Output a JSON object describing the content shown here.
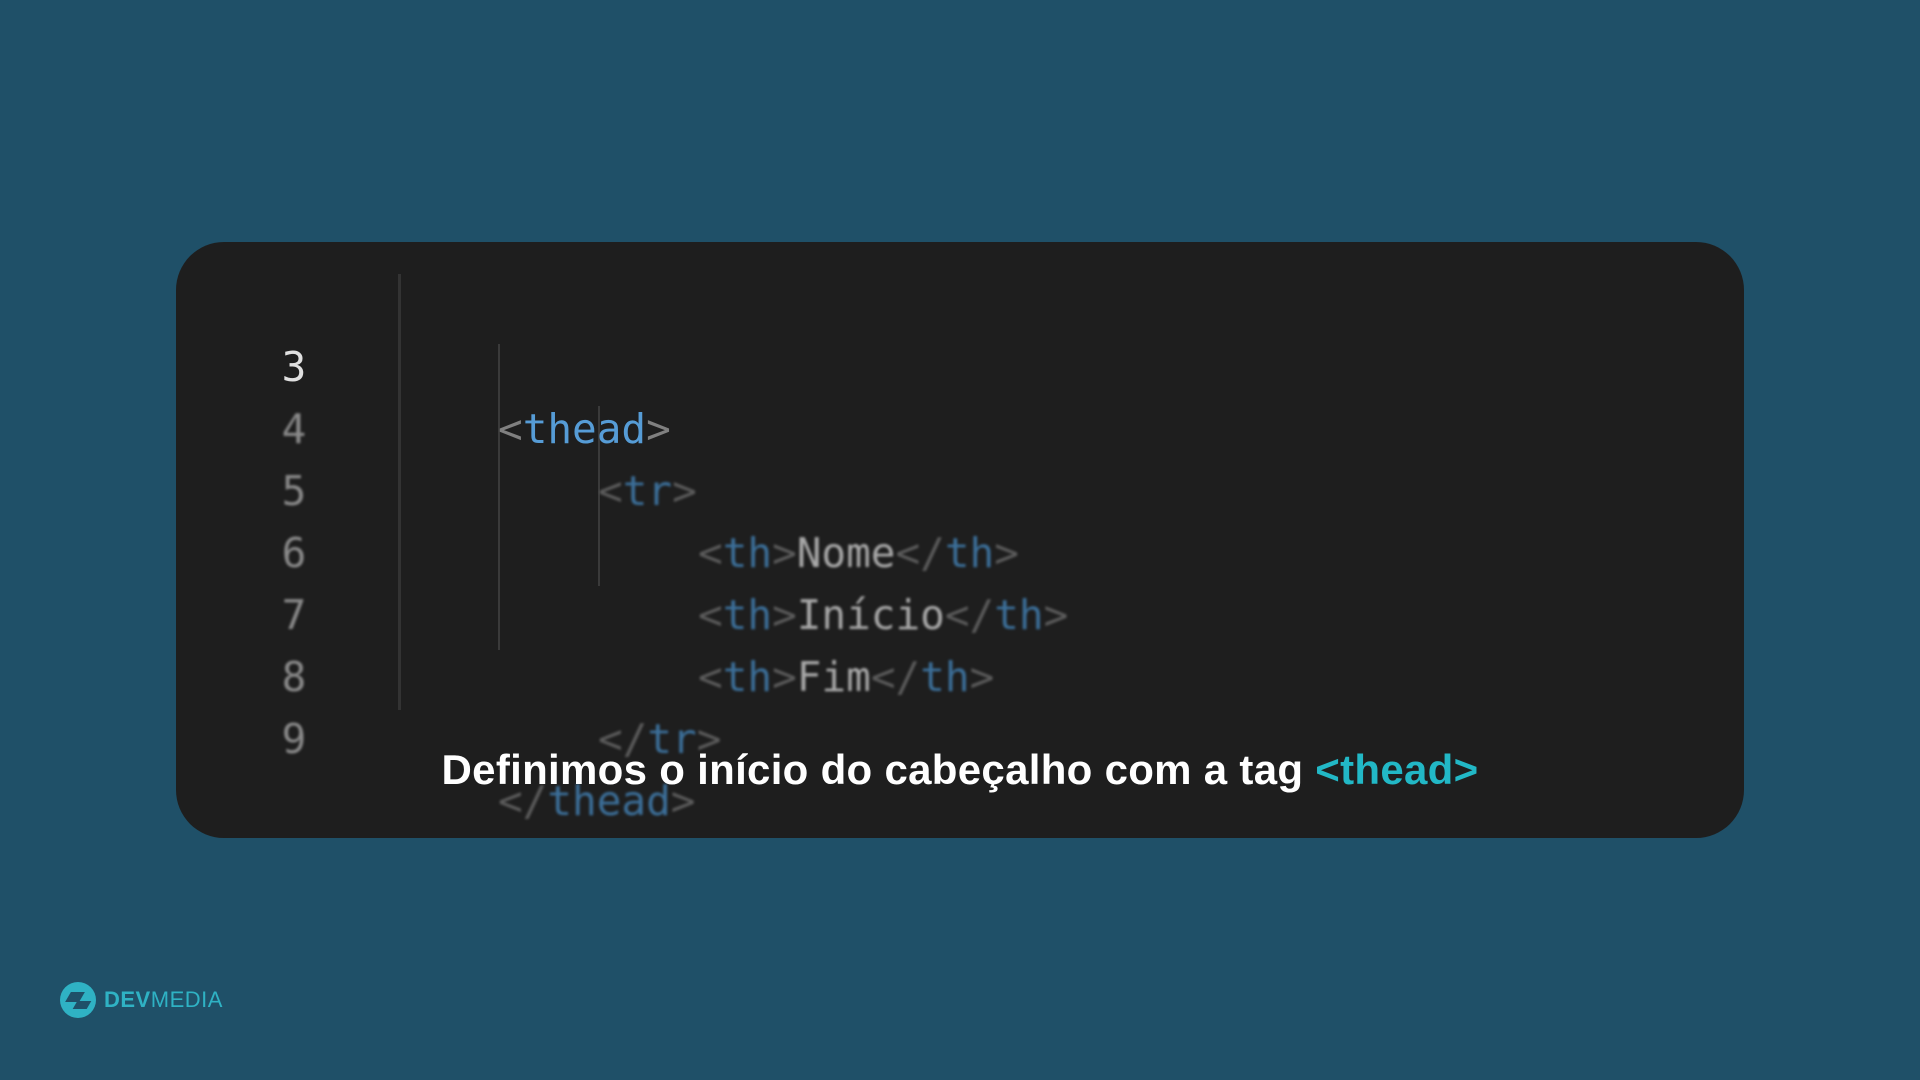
{
  "code": {
    "lines": [
      {
        "number": "3",
        "open": "<",
        "tag": "thead",
        "close": ">"
      },
      {
        "number": "4",
        "open": "<",
        "tag": "tr",
        "close": ">"
      },
      {
        "number": "5",
        "open": "<",
        "tag": "th",
        "close": ">",
        "text": "Nome",
        "end_open": "</",
        "end_tag": "th",
        "end_close": ">"
      },
      {
        "number": "6",
        "open": "<",
        "tag": "th",
        "close": ">",
        "text": "Início",
        "end_open": "</",
        "end_tag": "th",
        "end_close": ">"
      },
      {
        "number": "7",
        "open": "<",
        "tag": "th",
        "close": ">",
        "text": "Fim",
        "end_open": "</",
        "end_tag": "th",
        "end_close": ">"
      },
      {
        "number": "8",
        "open": "</",
        "tag": "tr",
        "close": ">"
      },
      {
        "number": "9",
        "open": "</",
        "tag": "thead",
        "close": ">"
      }
    ]
  },
  "caption": {
    "text": "Definimos o início  do cabeçalho com a tag ",
    "highlight": "<thead>"
  },
  "logo": {
    "bold": "DEV",
    "light": "MEDIA"
  },
  "colors": {
    "background": "#1f5068",
    "card": "#1e1e1e",
    "accent": "#22b8c6",
    "tag": "#569cd6"
  }
}
